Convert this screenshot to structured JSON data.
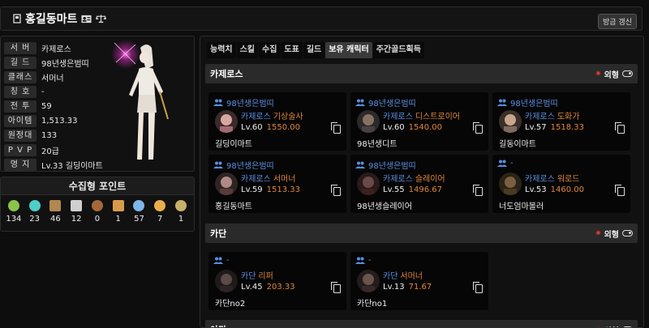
{
  "header": {
    "title": "홍길동마트",
    "refresh_label": "방금 갱신"
  },
  "profile": {
    "rows": [
      {
        "label": "서 버",
        "value": "카제로스"
      },
      {
        "label": "길 드",
        "value": "98년생은범띠"
      },
      {
        "label": "클래스",
        "value": "서머너"
      },
      {
        "label": "칭 호",
        "value": "-"
      },
      {
        "label": "전 투",
        "value": "59"
      },
      {
        "label": "아이템",
        "value": "1,513.33"
      },
      {
        "label": "원정대",
        "value": "133"
      },
      {
        "label": "P V P",
        "value": "20급"
      },
      {
        "label": "영 지",
        "value": "Lv.33 길딩이마트"
      }
    ]
  },
  "collection": {
    "title": "수집형 포인트",
    "items": [
      {
        "icon": "island-heart-icon",
        "count": "134",
        "color": "#8bc34a"
      },
      {
        "icon": "orpheus-star-icon",
        "count": "23",
        "color": "#4dd0c8"
      },
      {
        "icon": "giant-heart-icon",
        "count": "46",
        "color": "#b08850"
      },
      {
        "icon": "art-icon",
        "count": "12",
        "color": "#cfcfcf"
      },
      {
        "icon": "mokoko-seed-icon",
        "count": "0",
        "color": "#a5683a"
      },
      {
        "icon": "voyage-icon",
        "count": "1",
        "color": "#d89a4a"
      },
      {
        "icon": "world-tree-leaf-icon",
        "count": "57",
        "color": "#7fb6e8"
      },
      {
        "icon": "ignea-token-icon",
        "count": "7",
        "color": "#e8b04a"
      },
      {
        "icon": "sea-bounty-icon",
        "count": "1",
        "color": "#c8b06a"
      }
    ]
  },
  "tabs": [
    "능력치",
    "스킬",
    "수집",
    "도표",
    "길드",
    "보유 캐릭터",
    "주간골드획득"
  ],
  "active_tab": 5,
  "toggle_label": "외형",
  "servers": [
    {
      "name": "카제로스",
      "characters": [
        {
          "guild": "98년생은범띠",
          "server": "카제로스",
          "job": "기상술사",
          "level": "Lv.60",
          "ilvl": "1550.00",
          "name": "길딩이마트",
          "avatar": "#d9a7a0"
        },
        {
          "guild": "98년생은범띠",
          "server": "카제로스",
          "job": "디스트로이어",
          "level": "Lv.60",
          "ilvl": "1540.00",
          "name": "98년생디트",
          "avatar": "#8a7060"
        },
        {
          "guild": "98년생은범띠",
          "server": "카제로스",
          "job": "도화가",
          "level": "Lv.57",
          "ilvl": "1518.33",
          "name": "길동이마트",
          "avatar": "#c9a48c"
        },
        {
          "guild": "98년생은범띠",
          "server": "카제로스",
          "job": "서머너",
          "level": "Lv.59",
          "ilvl": "1513.33",
          "name": "홍길동마트",
          "avatar": "#b08a88"
        },
        {
          "guild": "98년생은범띠",
          "server": "카제로스",
          "job": "슬레이어",
          "level": "Lv.55",
          "ilvl": "1496.67",
          "name": "98년생슬레이어",
          "avatar": "#6a4a48"
        },
        {
          "guild": "-",
          "server": "카제로스",
          "job": "워로드",
          "level": "Lv.53",
          "ilvl": "1460.00",
          "name": "너도엄마볼러",
          "avatar": "#7a6040"
        }
      ]
    },
    {
      "name": "카단",
      "characters": [
        {
          "guild": "-",
          "server": "카단",
          "job": "리퍼",
          "level": "Lv.45",
          "ilvl": "203.33",
          "name": "카단no2",
          "avatar": "#5a4a48"
        },
        {
          "guild": "-",
          "server": "카단",
          "job": "서머너",
          "level": "Lv.13",
          "ilvl": "71.67",
          "name": "카단no1",
          "avatar": "#6a5450"
        }
      ]
    },
    {
      "name": "아만",
      "characters": []
    }
  ]
}
